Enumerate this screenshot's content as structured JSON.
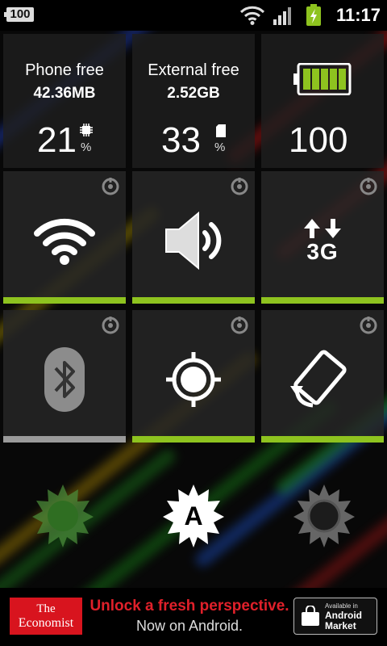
{
  "status_bar": {
    "battery_level_text": "100",
    "time": "11:17"
  },
  "info_tiles": {
    "phone": {
      "label": "Phone free",
      "value": "42.36MB",
      "percent": "21",
      "percent_sign": "%"
    },
    "external": {
      "label": "External free",
      "value": "2.52GB",
      "percent": "33",
      "percent_sign": "%"
    },
    "battery": {
      "percent": "100"
    }
  },
  "toggles": [
    {
      "name": "wifi",
      "state": "on",
      "bar_color": "#8ec31f"
    },
    {
      "name": "sound",
      "state": "on",
      "bar_color": "#8ec31f"
    },
    {
      "name": "mobile-data-3g",
      "label": "3G",
      "state": "on",
      "bar_color": "#8ec31f"
    },
    {
      "name": "bluetooth",
      "state": "off",
      "bar_color": "#9a9a9a"
    },
    {
      "name": "gps",
      "state": "on",
      "bar_color": "#8ec31f"
    },
    {
      "name": "auto-rotate",
      "state": "on",
      "bar_color": "#8ec31f"
    }
  ],
  "brightness": {
    "auto_label": "A",
    "options": [
      "low",
      "auto",
      "high"
    ]
  },
  "ad": {
    "logo_line1": "The",
    "logo_line2": "Economist",
    "headline": "Unlock a fresh perspective.",
    "subline": "Now on Android.",
    "market_small": "Available in",
    "market_big_1": "Android",
    "market_big_2": "Market"
  },
  "colors": {
    "accent_green": "#8ec31f",
    "off_gray": "#9a9a9a",
    "ad_red": "#d8141e"
  }
}
